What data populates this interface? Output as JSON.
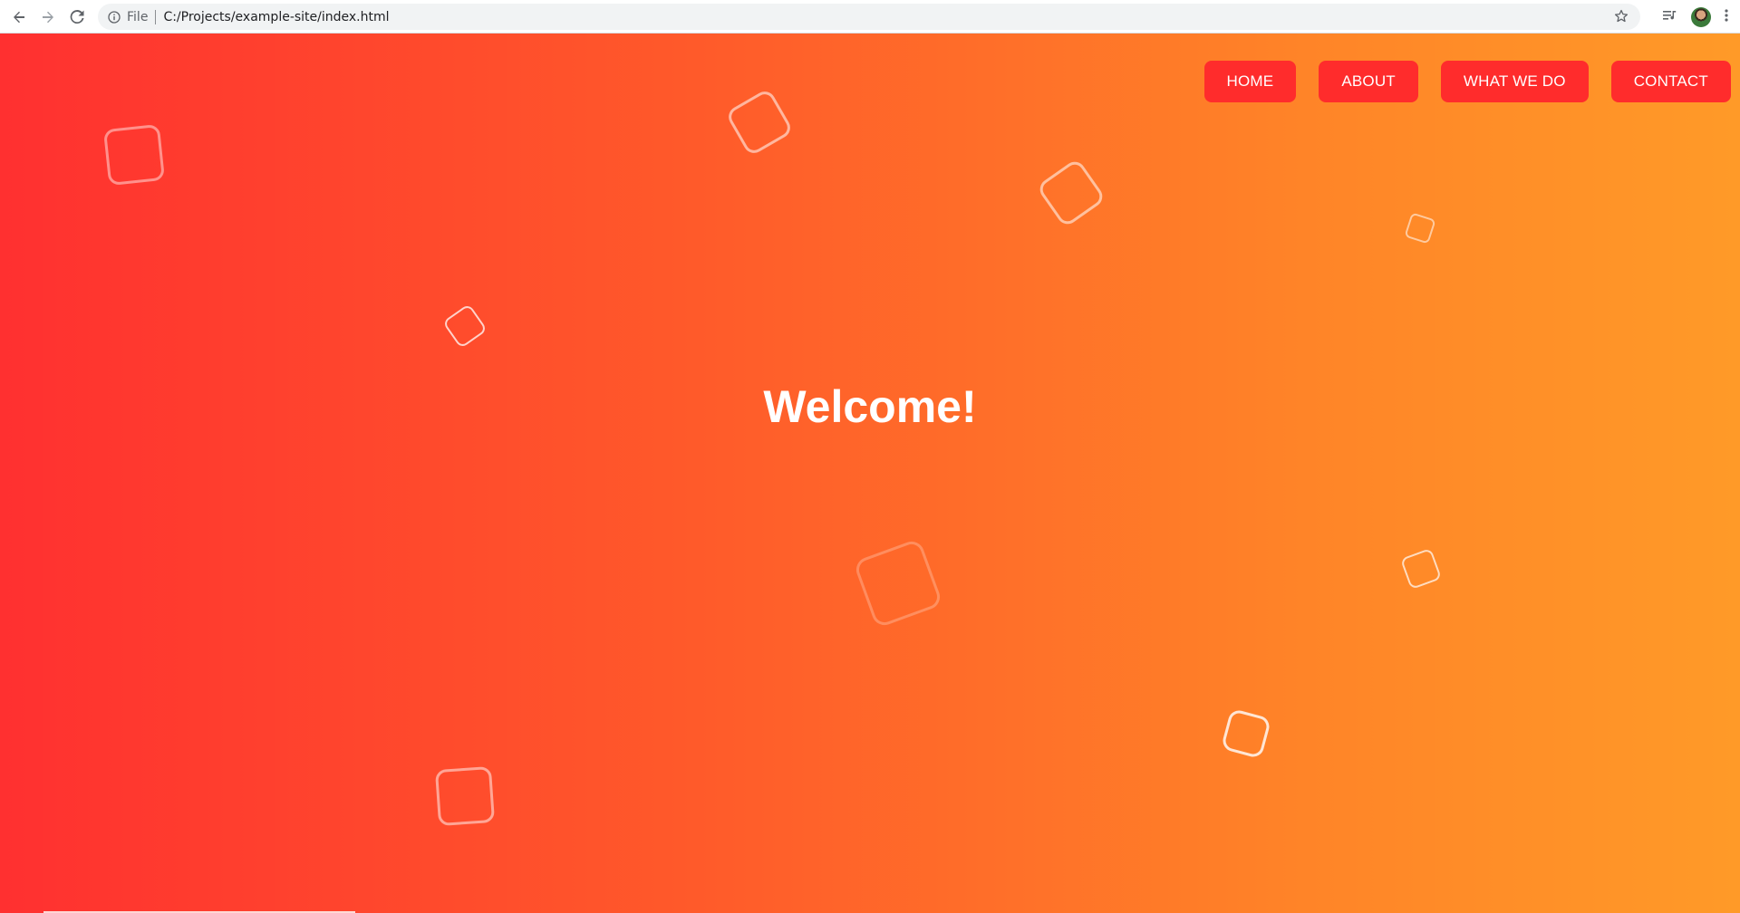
{
  "browser": {
    "scheme_label": "File",
    "url": "C:/Projects/example-site/index.html",
    "icons": [
      "back-arrow-icon",
      "forward-arrow-icon",
      "reload-icon",
      "info-icon",
      "star-icon",
      "reading-list-icon",
      "avatar",
      "more-menu-icon"
    ]
  },
  "nav": {
    "items": [
      {
        "label": "HOME"
      },
      {
        "label": "ABOUT"
      },
      {
        "label": "WHAT WE DO"
      },
      {
        "label": "CONTACT"
      }
    ]
  },
  "hero": {
    "title": "Welcome!"
  },
  "colors": {
    "gradient_start": "#ff3030",
    "gradient_end": "#ff9a28",
    "nav_button_bg": "#ff2c2c",
    "text": "#ffffff"
  }
}
